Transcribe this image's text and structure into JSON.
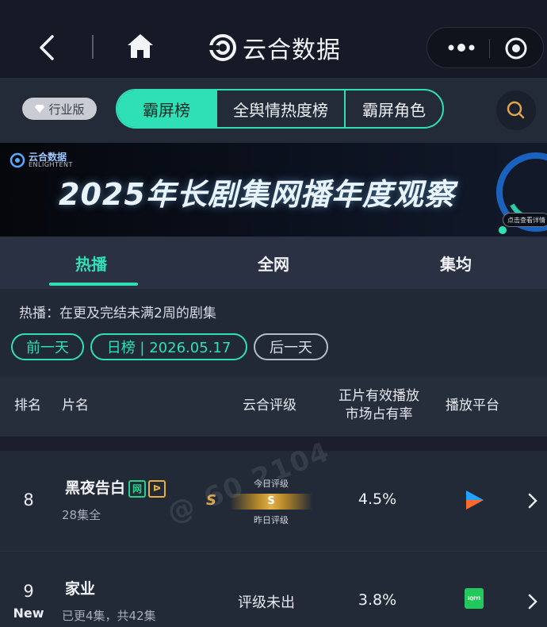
{
  "header": {
    "brand": "云合数据"
  },
  "tabrow": {
    "pro_label": "行业版",
    "tabs": [
      {
        "label": "霸屏榜",
        "active": true
      },
      {
        "label": "全舆情热度榜",
        "active": false
      },
      {
        "label": "霸屏角色",
        "active": false
      }
    ]
  },
  "banner": {
    "logo_cn": "云合数据",
    "logo_en": "ENLIGHTENT",
    "title": "2025年长剧集网播年度观察",
    "cta": "点击查看详情"
  },
  "subtabs": [
    {
      "label": "热播",
      "active": true
    },
    {
      "label": "全网",
      "active": false
    },
    {
      "label": "集均",
      "active": false
    }
  ],
  "filter": {
    "description": "热播：在更及完结未满2周的剧集",
    "prev_day": "前一天",
    "current": "日榜 | 2026.05.17",
    "next_day": "后一天"
  },
  "table": {
    "headers": {
      "rank": "排名",
      "title": "片名",
      "rating": "云合评级",
      "share_line1": "正片有效播放",
      "share_line2": "市场占有率",
      "platform": "播放平台"
    },
    "rows": [
      {
        "rank": "8",
        "title": "黑夜告白",
        "tag_net": "网",
        "subtitle": "28集全",
        "grade": "S",
        "today_label": "今日评级",
        "today_value": "S",
        "yesterday_label": "昨日评级",
        "share": "4.5%",
        "platform_icon": "youku-icon"
      },
      {
        "rank": "9",
        "badge": "New",
        "title": "家业",
        "subtitle": "已更4集，共42集",
        "rating_text": "评级未出",
        "share": "3.8%",
        "platform_icon": "iqiyi-icon",
        "platform_text": "iQIYI"
      }
    ]
  },
  "watermark": "@ 60 2104",
  "colors": {
    "accent": "#2fe0b7",
    "gold": "#d9a440",
    "background": "#1c2230"
  }
}
